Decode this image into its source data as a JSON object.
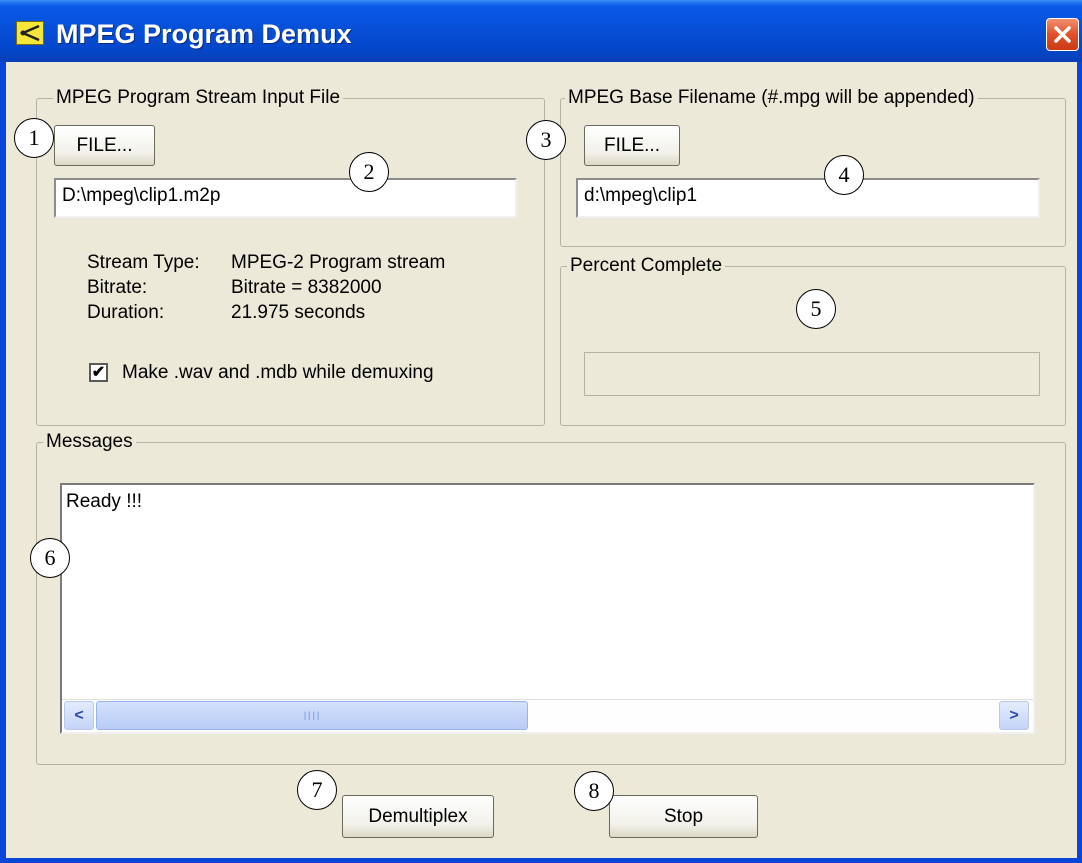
{
  "window": {
    "title": "MPEG Program Demux",
    "close_symbol": "✕"
  },
  "input_group": {
    "legend": "MPEG Program Stream Input File",
    "file_button": "FILE...",
    "path": "D:\\mpeg\\clip1.m2p",
    "info": [
      {
        "label": "Stream Type:",
        "value": "MPEG-2 Program stream"
      },
      {
        "label": "Bitrate:",
        "value": "Bitrate = 8382000"
      },
      {
        "label": "Duration:",
        "value": "21.975 seconds"
      }
    ],
    "checkbox": {
      "label": "Make .wav and .mdb while demuxing",
      "checked": true,
      "mark": "✔"
    }
  },
  "output_group": {
    "legend": "MPEG Base Filename (#.mpg will be appended)",
    "file_button": "FILE...",
    "path": "d:\\mpeg\\clip1"
  },
  "progress_group": {
    "legend": "Percent Complete",
    "progress": 0
  },
  "messages_group": {
    "legend": "Messages",
    "text": "Ready !!!",
    "scroll_left": "<",
    "scroll_right": ">",
    "scroll_grip": "IIII"
  },
  "buttons": {
    "demultiplex": "Demultiplex",
    "stop": "Stop"
  },
  "callouts": [
    "1",
    "2",
    "3",
    "4",
    "5",
    "6",
    "7",
    "8"
  ]
}
